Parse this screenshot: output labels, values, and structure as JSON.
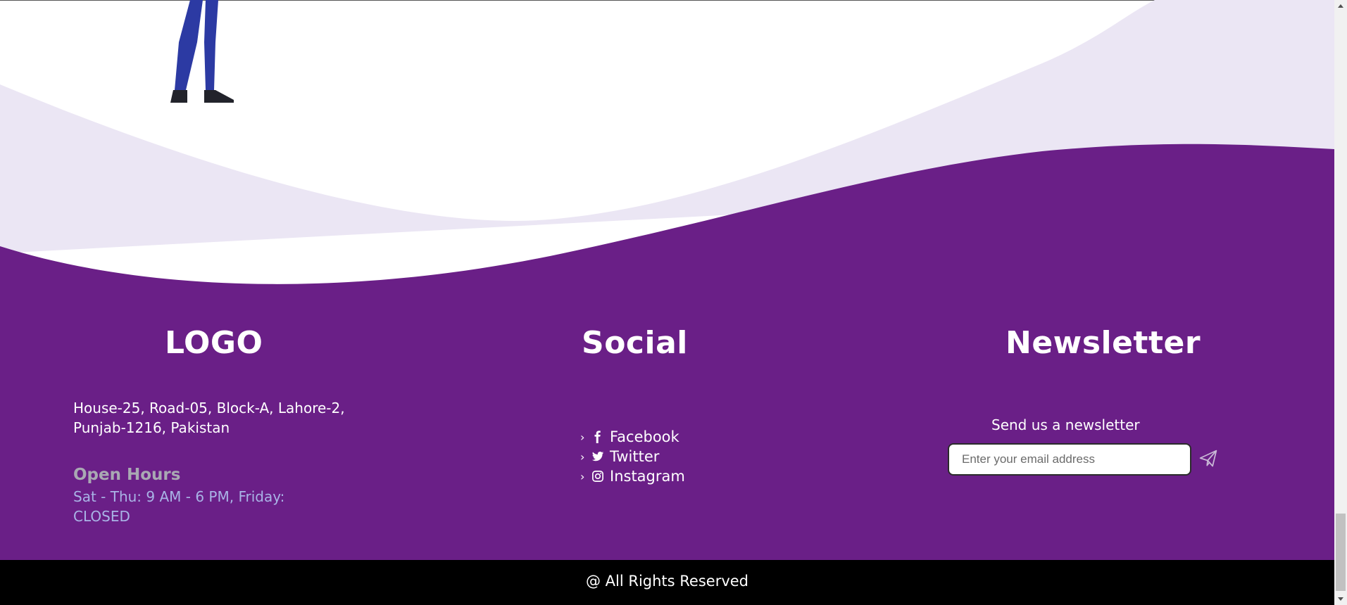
{
  "colors": {
    "footer_purple": "#6a1f87",
    "wave_light": "#ebe6f4",
    "white": "#ffffff",
    "bottom_bar": "#000000",
    "hours_title": "#a9a9b3",
    "hours_text": "#a9b4e6"
  },
  "footer": {
    "logo": {
      "title": "LOGO",
      "address_line1": "House-25, Road-05, Block-A, Lahore-2,",
      "address_line2": "Punjab-1216, Pakistan",
      "hours_title": "Open Hours",
      "hours_line1": "Sat - Thu: 9 AM - 6 PM, Friday:",
      "hours_line2": "CLOSED"
    },
    "social": {
      "title": "Social",
      "items": [
        {
          "label": "Facebook",
          "icon": "facebook-icon"
        },
        {
          "label": "Twitter",
          "icon": "twitter-icon"
        },
        {
          "label": "Instagram",
          "icon": "instagram-icon"
        }
      ]
    },
    "newsletter": {
      "title": "Newsletter",
      "caption": "Send us a newsletter",
      "email_placeholder": "Enter your email address",
      "submit_icon": "paper-plane-icon"
    }
  },
  "bottom_bar": {
    "copyright": "@ All Rights Reserved"
  }
}
